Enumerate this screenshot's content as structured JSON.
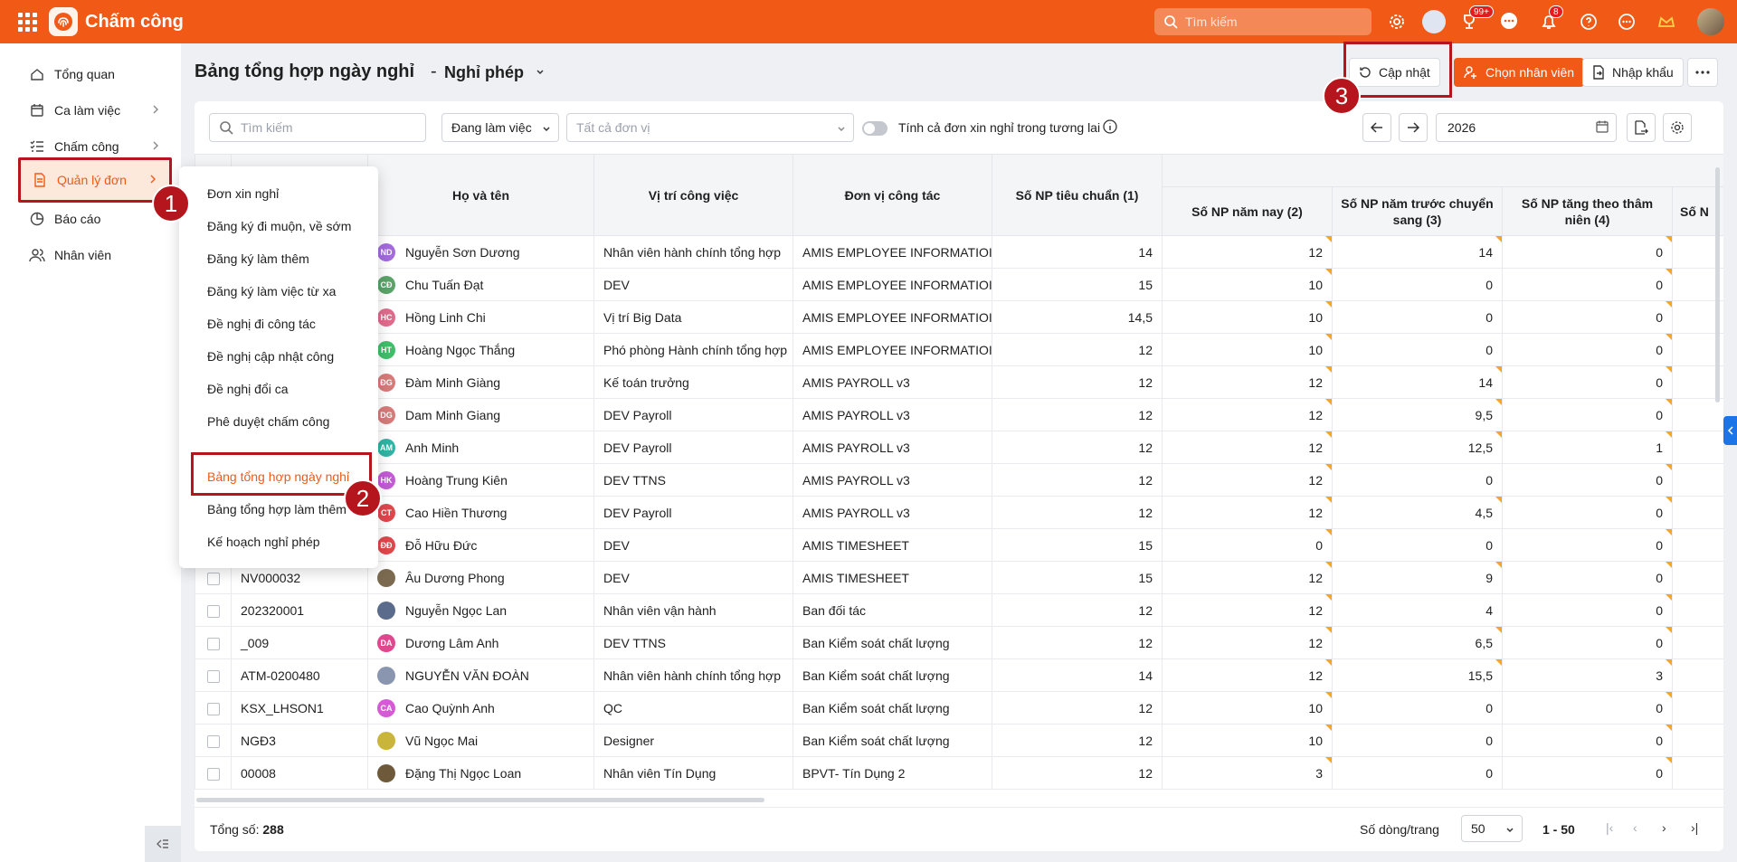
{
  "app": {
    "title": "Chấm công",
    "search_placeholder": "Tìm kiếm",
    "badge_apps": "99+",
    "badge_notifications": "8"
  },
  "colors": {
    "brand": "#f05a16",
    "highlight": "#b5161e",
    "edited_marker": "#f5a623"
  },
  "sidebar": {
    "items": [
      {
        "label": "Tổng quan",
        "icon": "home-icon"
      },
      {
        "label": "Ca làm việc",
        "icon": "calendar-icon"
      },
      {
        "label": "Chấm công",
        "icon": "checklist-icon"
      },
      {
        "label": "Quản lý đơn",
        "icon": "document-icon"
      },
      {
        "label": "Báo cáo",
        "icon": "pie-chart-icon"
      },
      {
        "label": "Nhân viên",
        "icon": "users-icon"
      }
    ]
  },
  "menu": {
    "items": [
      "Đơn xin nghỉ",
      "Đăng ký đi muộn, về sớm",
      "Đăng ký làm thêm",
      "Đăng ký làm việc từ xa",
      "Đề nghị đi công tác",
      "Đề nghị cập nhật công",
      "Đề nghị đổi ca",
      "Phê duyệt chấm công",
      "Bảng tổng hợp ngày nghỉ",
      "Bảng tổng hợp làm thêm",
      "Kế hoạch nghỉ phép"
    ]
  },
  "steps": [
    "1",
    "2",
    "3"
  ],
  "page": {
    "title": "Bảng tổng hợp ngày nghỉ",
    "separator": "-",
    "subtitle": "Nghỉ phép",
    "btn_update": "Cập nhật",
    "btn_choose": "Chọn nhân viên",
    "btn_import": "Nhập khẩu"
  },
  "filters": {
    "search_placeholder": "Tìm kiếm",
    "status": "Đang làm việc",
    "unit_placeholder": "Tất cả đơn vị",
    "future_toggle_label": "Tính cả đơn xin nghỉ trong tương lai",
    "year": "2026"
  },
  "table": {
    "headers": {
      "name": "Họ và tên",
      "position": "Vị trí công việc",
      "unit": "Đơn vị công tác",
      "std": "Số NP tiêu chuẩn (1)",
      "group": "Số",
      "this_year": "Số NP năm nay (2)",
      "carry": "Số NP năm trước chuyển sang (3)",
      "senior": "Số NP tăng theo thâm niên (4)",
      "next": "Số N"
    },
    "rows": [
      {
        "code": "",
        "initials": "ND",
        "color": "#a46cdb",
        "name": "Nguyễn Sơn Dương",
        "position": "Nhân viên hành chính tổng hợp",
        "unit": "AMIS EMPLOYEE INFORMATIOI",
        "std": "14",
        "this_year": "12",
        "carry": "14",
        "senior": "0"
      },
      {
        "code": "",
        "initials": "CĐ",
        "color": "#5aa469",
        "name": "Chu Tuấn Đạt",
        "position": "DEV",
        "unit": "AMIS EMPLOYEE INFORMATIOI",
        "std": "15",
        "this_year": "10",
        "carry": "0",
        "senior": "0"
      },
      {
        "code": "",
        "initials": "HC",
        "color": "#e06c8c",
        "name": "Hồng Linh Chi",
        "position": "Vị trí Big Data",
        "unit": "AMIS EMPLOYEE INFORMATIOI",
        "std": "14,5",
        "this_year": "10",
        "carry": "0",
        "senior": "0"
      },
      {
        "code": "",
        "initials": "HT",
        "color": "#3fbf6a",
        "name": "Hoàng Ngọc Thắng",
        "position": "Phó phòng Hành chính tổng hợp",
        "unit": "AMIS EMPLOYEE INFORMATIOI",
        "std": "12",
        "this_year": "10",
        "carry": "0",
        "senior": "0"
      },
      {
        "code": "",
        "initials": "ĐG",
        "color": "#d87a7a",
        "name": "Đàm Minh Giàng",
        "position": "Kế toán trưởng",
        "unit": "AMIS PAYROLL v3",
        "std": "12",
        "this_year": "12",
        "carry": "14",
        "senior": "0"
      },
      {
        "code": "",
        "initials": "DG",
        "color": "#d87a7a",
        "name": "Dam Minh Giang",
        "position": "DEV Payroll",
        "unit": "AMIS PAYROLL v3",
        "std": "12",
        "this_year": "12",
        "carry": "9,5",
        "senior": "0"
      },
      {
        "code": "",
        "initials": "AM",
        "color": "#2fb5a5",
        "name": "Anh Minh",
        "position": "DEV Payroll",
        "unit": "AMIS PAYROLL v3",
        "std": "12",
        "this_year": "12",
        "carry": "12,5",
        "senior": "1"
      },
      {
        "code": "",
        "initials": "HK",
        "color": "#c45ad6",
        "name": "Hoàng Trung Kiên",
        "position": "DEV TTNS",
        "unit": "AMIS PAYROLL v3",
        "std": "12",
        "this_year": "12",
        "carry": "0",
        "senior": "0"
      },
      {
        "code": "",
        "initials": "CT",
        "color": "#e0474c",
        "name": "Cao Hiền Thương",
        "position": "DEV Payroll",
        "unit": "AMIS PAYROLL v3",
        "std": "12",
        "this_year": "12",
        "carry": "4,5",
        "senior": "0"
      },
      {
        "code": "",
        "initials": "ĐĐ",
        "color": "#e0474c",
        "name": "Đỗ Hữu Đức",
        "position": "DEV",
        "unit": "AMIS TIMESHEET",
        "std": "15",
        "this_year": "0",
        "carry": "0",
        "senior": "0"
      },
      {
        "code": "NV000032",
        "initials": "",
        "color": "#7b6a4f",
        "name": "Âu Dương Phong",
        "position": "DEV",
        "unit": "AMIS TIMESHEET",
        "std": "15",
        "this_year": "12",
        "carry": "9",
        "senior": "0"
      },
      {
        "code": "202320001",
        "initials": "",
        "color": "#5b6b8c",
        "name": "Nguyễn Ngọc Lan",
        "position": "Nhân viên vận hành",
        "unit": "Ban đối tác",
        "std": "12",
        "this_year": "12",
        "carry": "4",
        "senior": "0"
      },
      {
        "code": "_009",
        "initials": "DA",
        "color": "#e0478f",
        "name": "Dương Lâm Anh",
        "position": "DEV TTNS",
        "unit": "Ban Kiểm soát chất lượng",
        "std": "12",
        "this_year": "12",
        "carry": "6,5",
        "senior": "0"
      },
      {
        "code": "ATM-0200480",
        "initials": "",
        "color": "#8a96b0",
        "name": "NGUYỄN VĂN ĐOÀN",
        "position": "Nhân viên hành chính tổng hợp",
        "unit": "Ban Kiểm soát chất lượng",
        "std": "14",
        "this_year": "12",
        "carry": "15,5",
        "senior": "3"
      },
      {
        "code": "KSX_LHSON1",
        "initials": "CA",
        "color": "#d65ad6",
        "name": "Cao Quỳnh Anh",
        "position": "QC",
        "unit": "Ban Kiểm soát chất lượng",
        "std": "12",
        "this_year": "10",
        "carry": "0",
        "senior": "0"
      },
      {
        "code": "NGĐ3",
        "initials": "",
        "color": "#c9b53a",
        "name": "Vũ Ngọc Mai",
        "position": "Designer",
        "unit": "Ban Kiểm soát chất lượng",
        "std": "12",
        "this_year": "10",
        "carry": "0",
        "senior": "0"
      },
      {
        "code": "00008",
        "initials": "",
        "color": "#6e5a3a",
        "name": "Đặng Thị Ngọc Loan",
        "position": "Nhân viên Tín Dụng",
        "unit": "BPVT- Tín Dụng 2",
        "std": "12",
        "this_year": "3",
        "carry": "0",
        "senior": "0"
      }
    ]
  },
  "footer": {
    "total_label": "Tổng số:",
    "total": "288",
    "rows_per_page_label": "Số dòng/trang",
    "rows_per_page": "50",
    "range": "1 - 50"
  }
}
